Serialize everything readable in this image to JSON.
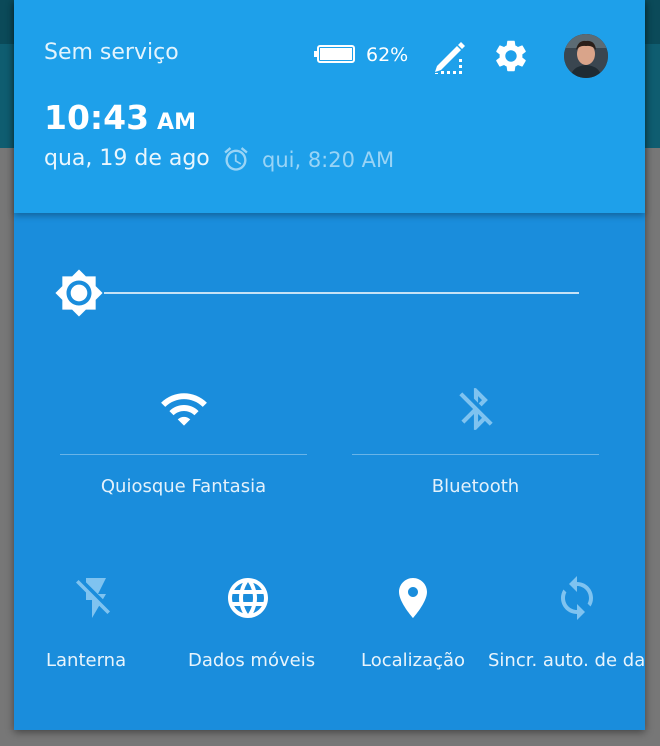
{
  "status": {
    "carrier": "Sem serviço",
    "battery_percent": "62%",
    "battery_level": 0.62
  },
  "header": {
    "time": "10:43",
    "ampm": "AM",
    "date": "qua, 19 de ago",
    "alarm": "qui, 8:20 AM"
  },
  "brightness": {
    "level": 0.0
  },
  "tiles_large": [
    {
      "label": "Quiosque Fantasia",
      "icon": "wifi-icon",
      "active": true
    },
    {
      "label": "Bluetooth",
      "icon": "bluetooth-disabled-icon",
      "active": false
    }
  ],
  "tiles_small": [
    {
      "label": "Lanterna",
      "icon": "flashlight-off-icon",
      "active": false
    },
    {
      "label": "Dados móveis",
      "icon": "globe-icon",
      "active": true
    },
    {
      "label": "Localização",
      "icon": "location-pin-icon",
      "active": true
    },
    {
      "label": "Sincr. auto. de dados",
      "icon": "sync-icon",
      "active": false
    }
  ],
  "colors": {
    "panel": "#1a8ddc",
    "header": "#1ea0ea",
    "active_icon": "#ffffff",
    "inactive_icon": "#7fc3f0"
  }
}
